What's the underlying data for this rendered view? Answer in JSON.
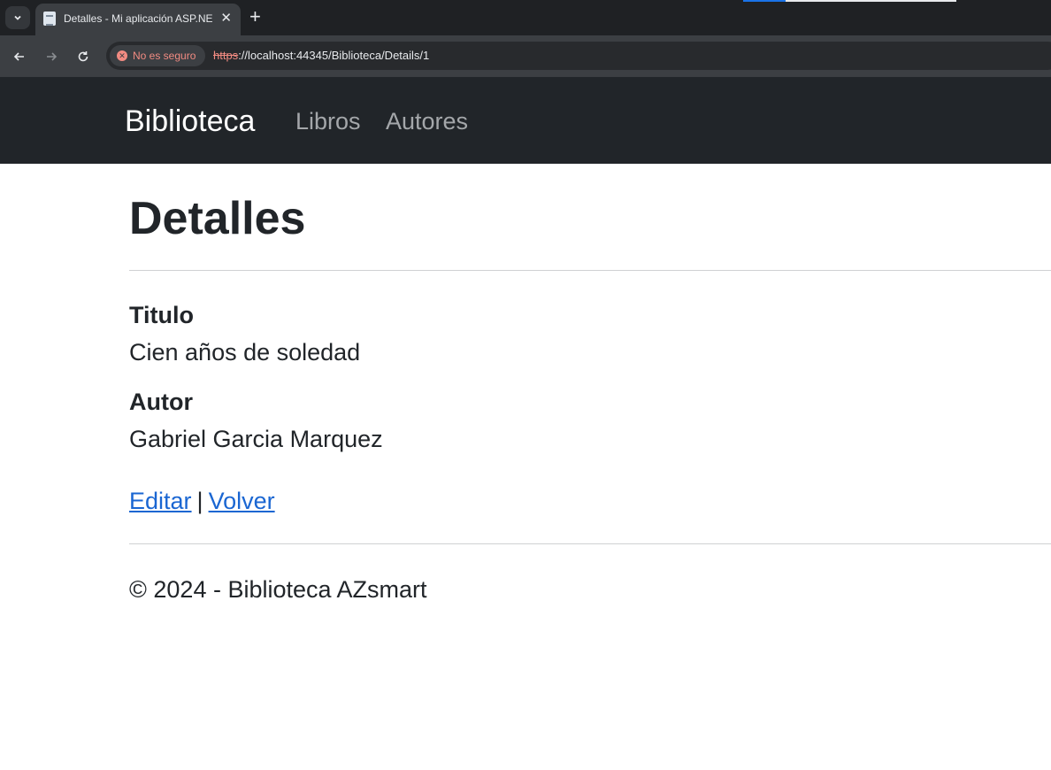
{
  "browser": {
    "tab_title": "Detalles - Mi aplicación ASP.NET",
    "security_label": "No es seguro",
    "url_scheme": "https",
    "url_rest": "://localhost:44345/Biblioteca/Details/1"
  },
  "navbar": {
    "brand": "Biblioteca",
    "links": [
      "Libros",
      "Autores"
    ]
  },
  "page": {
    "title": "Detalles",
    "fields": [
      {
        "label": "Titulo",
        "value": "Cien años de soledad"
      },
      {
        "label": "Autor",
        "value": "Gabriel Garcia Marquez"
      }
    ],
    "actions": {
      "edit": "Editar",
      "separator": "|",
      "back": "Volver"
    }
  },
  "footer": {
    "text": "© 2024 - Biblioteca AZsmart"
  },
  "colors": {
    "navbar": "#212529",
    "link": "#1a66d2",
    "insecure": "#f28b82"
  }
}
